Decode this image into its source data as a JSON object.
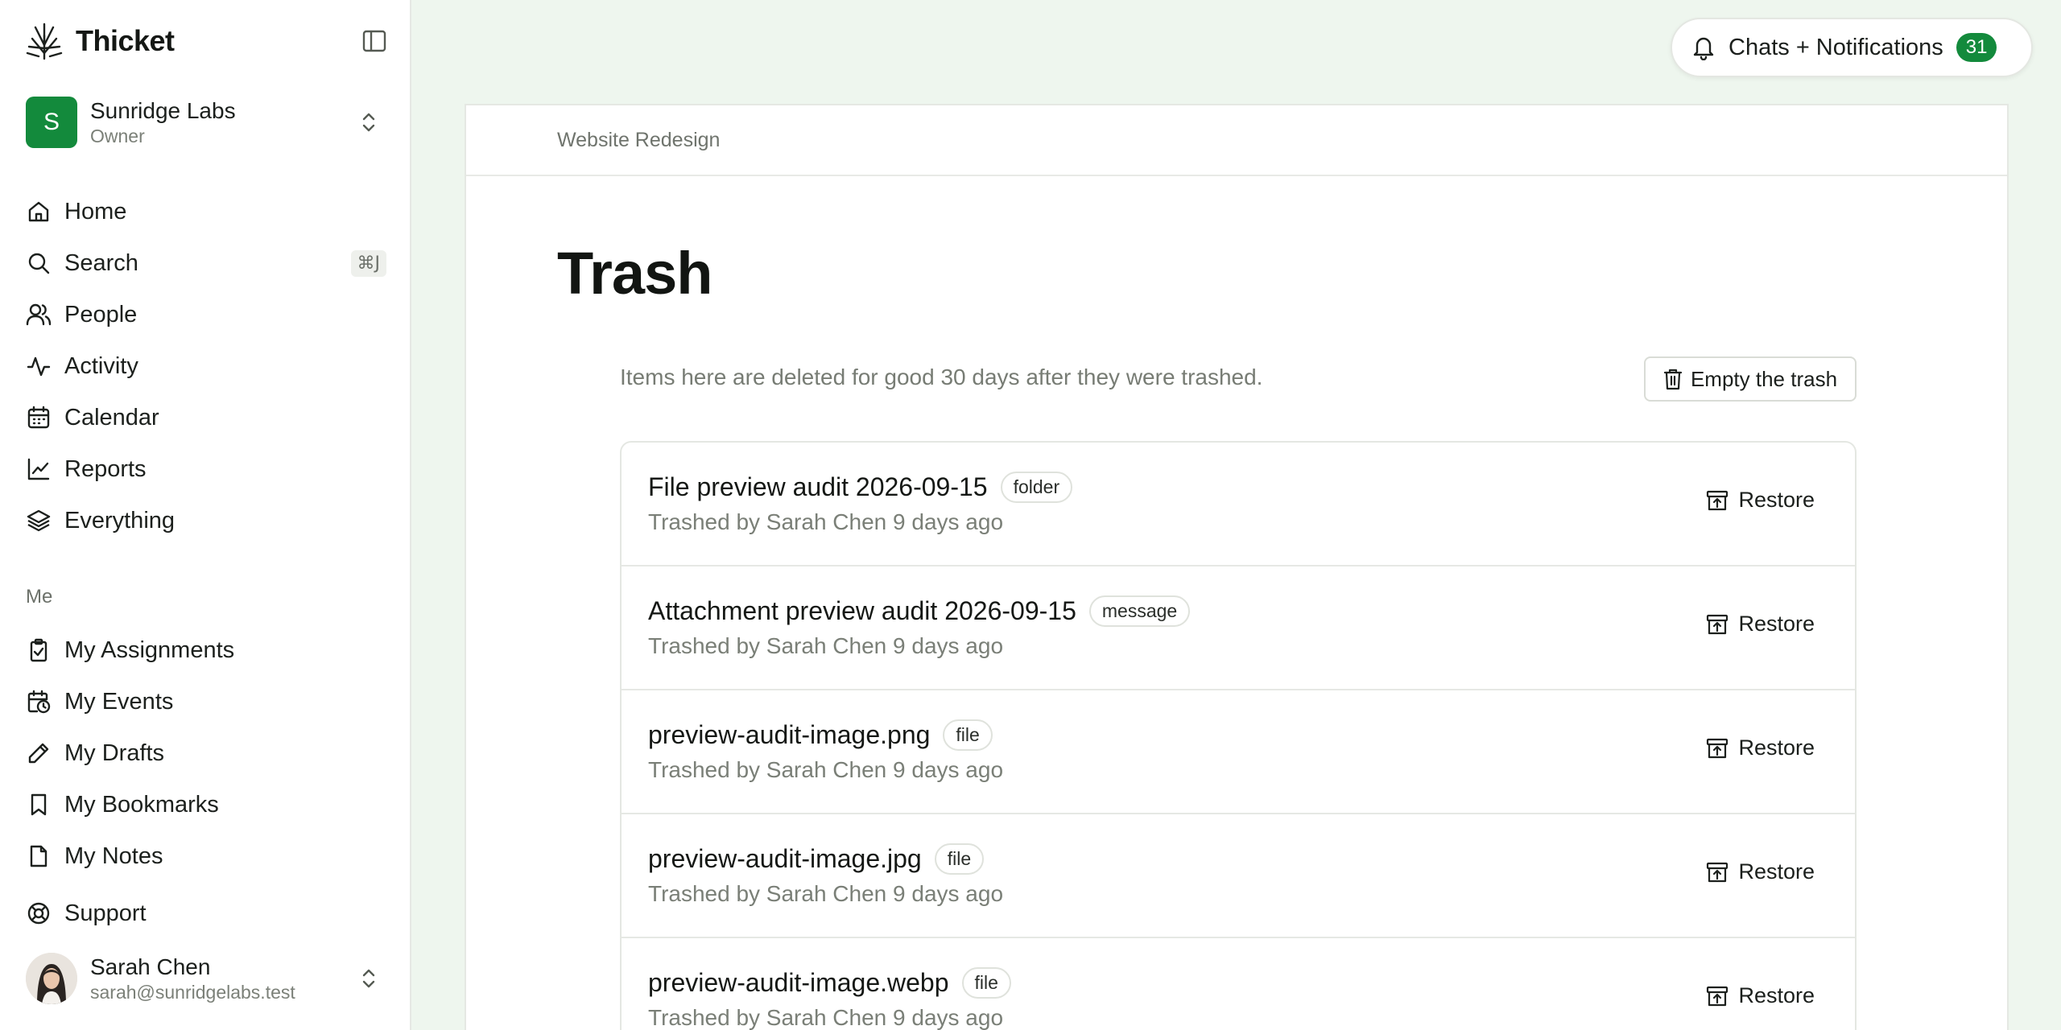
{
  "app": {
    "name": "Thicket"
  },
  "org": {
    "initial": "S",
    "name": "Sunridge Labs",
    "role": "Owner"
  },
  "nav": [
    {
      "label": "Home",
      "icon": "home-icon"
    },
    {
      "label": "Search",
      "icon": "search-icon",
      "shortcut": "⌘J"
    },
    {
      "label": "People",
      "icon": "people-icon"
    },
    {
      "label": "Activity",
      "icon": "activity-icon"
    },
    {
      "label": "Calendar",
      "icon": "calendar-icon"
    },
    {
      "label": "Reports",
      "icon": "chart-icon"
    },
    {
      "label": "Everything",
      "icon": "layers-icon"
    }
  ],
  "me_section": {
    "label": "Me",
    "items": [
      {
        "label": "My Assignments",
        "icon": "clipboard-check-icon"
      },
      {
        "label": "My Events",
        "icon": "calendar-clock-icon"
      },
      {
        "label": "My Drafts",
        "icon": "pencil-icon"
      },
      {
        "label": "My Bookmarks",
        "icon": "bookmark-icon"
      },
      {
        "label": "My Notes",
        "icon": "note-icon"
      }
    ]
  },
  "support": {
    "label": "Support",
    "icon": "lifebuoy-icon"
  },
  "user": {
    "name": "Sarah Chen",
    "email": "sarah@sunridgelabs.test"
  },
  "notifications": {
    "label": "Chats + Notifications",
    "count": "31"
  },
  "breadcrumb": "Website Redesign",
  "page": {
    "title": "Trash",
    "helper": "Items here are deleted for good 30 days after they were trashed.",
    "empty_button": "Empty the trash"
  },
  "items": [
    {
      "title": "File preview audit 2026-09-15",
      "type": "folder",
      "meta": "Trashed by Sarah Chen 9 days ago",
      "action": "Restore"
    },
    {
      "title": "Attachment preview audit 2026-09-15",
      "type": "message",
      "meta": "Trashed by Sarah Chen 9 days ago",
      "action": "Restore"
    },
    {
      "title": "preview-audit-image.png",
      "type": "file",
      "meta": "Trashed by Sarah Chen 9 days ago",
      "action": "Restore"
    },
    {
      "title": "preview-audit-image.jpg",
      "type": "file",
      "meta": "Trashed by Sarah Chen 9 days ago",
      "action": "Restore"
    },
    {
      "title": "preview-audit-image.webp",
      "type": "file",
      "meta": "Trashed by Sarah Chen 9 days ago",
      "action": "Restore"
    }
  ],
  "colors": {
    "accent": "#138a3c",
    "background": "#eef6ee",
    "muted_text": "#7a7f77"
  }
}
